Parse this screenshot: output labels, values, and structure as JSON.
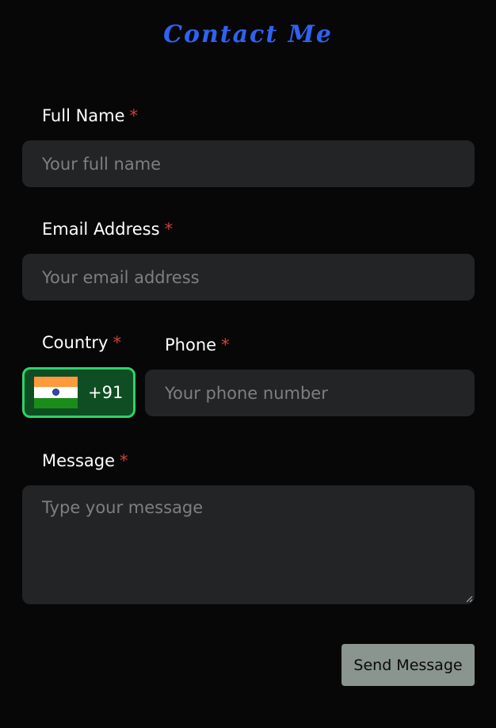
{
  "form": {
    "title": "Contact Me",
    "required_marker": "*",
    "full_name": {
      "label": "Full Name",
      "placeholder": "Your full name",
      "value": ""
    },
    "email": {
      "label": "Email Address",
      "placeholder": "Your email address",
      "value": ""
    },
    "country": {
      "label": "Country",
      "flag_icon": "india-flag-icon",
      "dial_code": "+91"
    },
    "phone": {
      "label": "Phone",
      "placeholder": "Your phone number",
      "value": ""
    },
    "message": {
      "label": "Message",
      "placeholder": "Type your message",
      "value": ""
    },
    "submit_label": "Send Message"
  },
  "colors": {
    "background": "#070707",
    "title": "#2f62f2",
    "required": "#d0403a",
    "field_bg": "#232425",
    "country_border": "#2dd36a",
    "country_bg": "#0f4e22",
    "button_bg": "#8a958f"
  }
}
